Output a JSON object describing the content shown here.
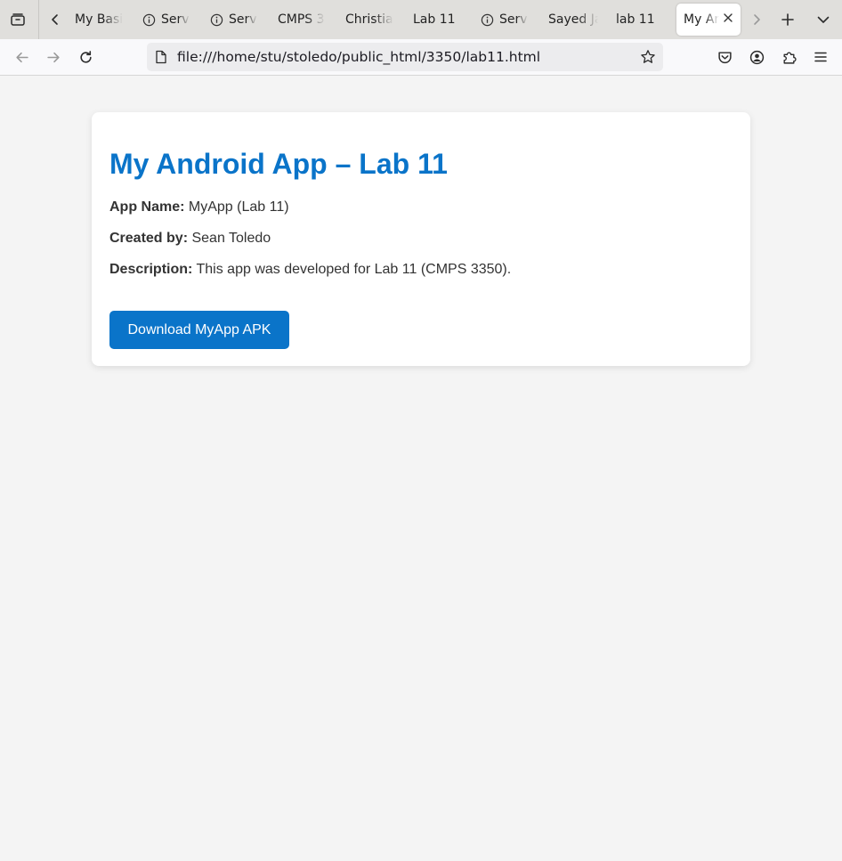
{
  "browser": {
    "tabs": [
      {
        "label": "My Basi",
        "has_info_icon": false
      },
      {
        "label": "Serv",
        "has_info_icon": true
      },
      {
        "label": "Serv",
        "has_info_icon": true
      },
      {
        "label": "CMPS 3",
        "has_info_icon": false
      },
      {
        "label": "Christia",
        "has_info_icon": false
      },
      {
        "label": "Lab 11",
        "has_info_icon": false
      },
      {
        "label": "Serv",
        "has_info_icon": true
      },
      {
        "label": "Sayed Ja",
        "has_info_icon": false
      },
      {
        "label": "lab 11",
        "has_info_icon": false
      },
      {
        "label": "My An",
        "has_info_icon": false,
        "active": true
      }
    ],
    "url": "file:///home/stu/stoledo/public_html/3350/lab11.html",
    "icons": {
      "tab_overview": "tab-overview-icon",
      "scroll_left": "chevron-left-icon",
      "scroll_right": "chevron-right-icon",
      "new_tab": "plus-icon",
      "list_tabs": "chevron-down-icon",
      "back": "arrow-left-icon",
      "forward": "arrow-right-icon",
      "reload": "reload-icon",
      "page": "page-icon",
      "bookmark": "star-icon",
      "pocket": "pocket-icon",
      "account": "account-icon",
      "extensions": "puzzle-icon",
      "menu": "hamburger-icon"
    }
  },
  "page": {
    "title": "My Android App – Lab 11",
    "app_name_label": "App Name:",
    "app_name": "MyApp (Lab 11)",
    "created_by_label": "Created by:",
    "created_by": "Sean Toledo",
    "description_label": "Description:",
    "description": "This app was developed for Lab 11 (CMPS 3350).",
    "download_label": "Download MyApp APK"
  },
  "colors": {
    "accent": "#0a74c9",
    "page_bg": "#f4f4f4",
    "card_bg": "#ffffff",
    "text": "#333333"
  }
}
